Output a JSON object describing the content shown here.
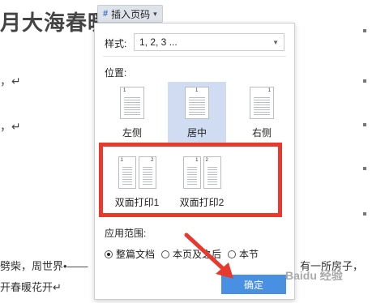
{
  "document": {
    "title": "月大海春暖",
    "marks": [
      "，↵",
      "，↵"
    ],
    "bottom_lines": [
      "劈柴，周世界•——",
      "开春暖花开↵",
      "有一所房子，"
    ]
  },
  "toolbar": {
    "button_label": "插入页码",
    "icon": "page-number-icon"
  },
  "dialog": {
    "style_label": "样式:",
    "style_value": "1, 2, 3 ...",
    "position_label": "位置:",
    "positions": [
      {
        "label": "左侧",
        "num": "1"
      },
      {
        "label": "居中",
        "num": "1"
      },
      {
        "label": "右侧",
        "num": "1"
      }
    ],
    "duplex": [
      {
        "label": "双面打印1",
        "nums": [
          "1",
          "2"
        ]
      },
      {
        "label": "双面打印2",
        "nums": [
          "1",
          "2"
        ]
      }
    ],
    "scope_label": "应用范围:",
    "scope_options": [
      "整篇文档",
      "本页及之后",
      "本节"
    ],
    "selected_scope": "整篇文档",
    "ok_label": "确定"
  },
  "watermark": "Baidu 经验",
  "colors": {
    "accent": "#4a90e2",
    "highlight": "#e8392e",
    "selected": "#cfdcf2"
  }
}
